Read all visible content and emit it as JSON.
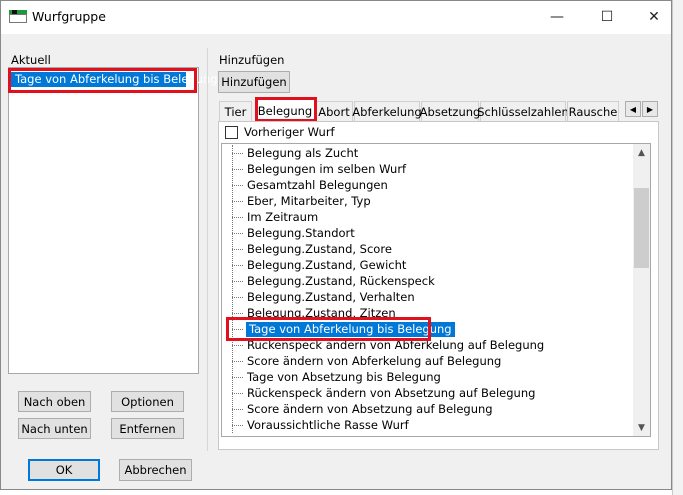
{
  "window": {
    "title": "Wurfgruppe"
  },
  "titlebar": {
    "minimize": "—",
    "maximize": "☐",
    "close": "✕"
  },
  "aktuell": {
    "label": "Aktuell",
    "items": [
      "Tage von Abferkelung bis Belegung"
    ]
  },
  "left_buttons": {
    "up": "Nach oben",
    "options": "Optionen",
    "down": "Nach unten",
    "remove": "Entfernen"
  },
  "hinzufuegen": {
    "label": "Hinzufügen",
    "button": "Hinzufügen"
  },
  "tabs": [
    "Tier",
    "Belegung",
    "Abort",
    "Abferkelung",
    "Absetzung",
    "Schlüsselzahlen",
    "Rausche"
  ],
  "active_tab": "Belegung",
  "checkbox": {
    "label": "Vorheriger Wurf",
    "checked": false
  },
  "tree_items": [
    "Belegung als Zucht",
    "Belegungen im selben Wurf",
    "Gesamtzahl Belegungen",
    "Eber, Mitarbeiter, Typ",
    "Im Zeitraum",
    "Belegung.Standort",
    "Belegung.Zustand, Score",
    "Belegung.Zustand, Gewicht",
    "Belegung.Zustand, Rückenspeck",
    "Belegung.Zustand, Verhalten",
    "Belegung.Zustand, Zitzen",
    "Tage von Abferkelung bis Belegung",
    "Rückenspeck ändern von Abferkelung auf Belegung",
    "Score ändern von Abferkelung auf Belegung",
    "Tage von Absetzung bis Belegung",
    "Rückenspeck ändern von Absetzung auf Belegung",
    "Score ändern von Absetzung auf Belegung",
    "Voraussichtliche Rasse Wurf"
  ],
  "selected_tree_item": "Tage von Abferkelung bis Belegung",
  "footer": {
    "ok": "OK",
    "cancel": "Abbrechen"
  },
  "colors": {
    "selection": "#0078d7",
    "highlight_box": "#e0101e",
    "dialog_bg": "#f0f0f0"
  }
}
